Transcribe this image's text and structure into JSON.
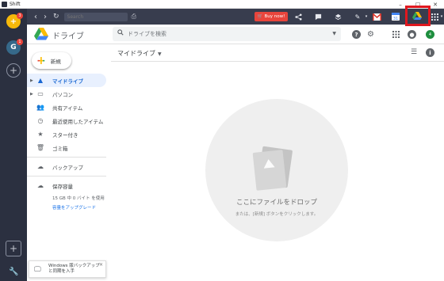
{
  "window": {
    "title": "Shift",
    "controls": {
      "minimize": "–",
      "maximize": "□",
      "close": "✕"
    }
  },
  "rail": {
    "accounts": [
      {
        "letter": "+",
        "badge": "3",
        "color": "#f6b90a"
      },
      {
        "letter": "G",
        "badge": "1",
        "color": "#36698a"
      }
    ],
    "add_label": "+",
    "add2_label": "+"
  },
  "toolbar": {
    "back": "‹",
    "forward": "›",
    "search_placeholder": "Search",
    "buy_label": "Buy now!",
    "highlight_color": "#e0181f",
    "app_icons": [
      "share-icon",
      "chat-icon",
      "layers-icon",
      "pen-icon",
      "gmail-icon",
      "calendar-icon",
      "drive-icon",
      "apps-grid-icon"
    ]
  },
  "drive_header": {
    "title": "ドライブ",
    "search_placeholder": "ドライブを検索",
    "avatar_letter": "4"
  },
  "sidebar": {
    "new_label": "新規",
    "items": [
      {
        "label": "マイドライブ",
        "icon": "drive-folder-icon",
        "active": true,
        "arrow": true
      },
      {
        "label": "パソコン",
        "icon": "computer-icon",
        "active": false,
        "arrow": true
      },
      {
        "label": "共有アイテム",
        "icon": "people-icon",
        "active": false,
        "arrow": false
      },
      {
        "label": "最近使用したアイテム",
        "icon": "clock-icon",
        "active": false,
        "arrow": false
      },
      {
        "label": "スター付き",
        "icon": "star-icon",
        "active": false,
        "arrow": false
      },
      {
        "label": "ゴミ箱",
        "icon": "trash-icon",
        "active": false,
        "arrow": false
      }
    ],
    "backup_label": "バックアップ",
    "storage_label": "保存容量",
    "storage_used": "15 GB 中 0 バイト を使用",
    "upgrade_label": "容量をアップグレード"
  },
  "toast": {
    "text": "Windows 版バックアップと同期を入手",
    "close": "×"
  },
  "main": {
    "breadcrumb": "マイドライブ",
    "drop_title": "ここにファイルをドロップ",
    "drop_subtitle": "または、[新規] ボタンをクリックします。"
  }
}
